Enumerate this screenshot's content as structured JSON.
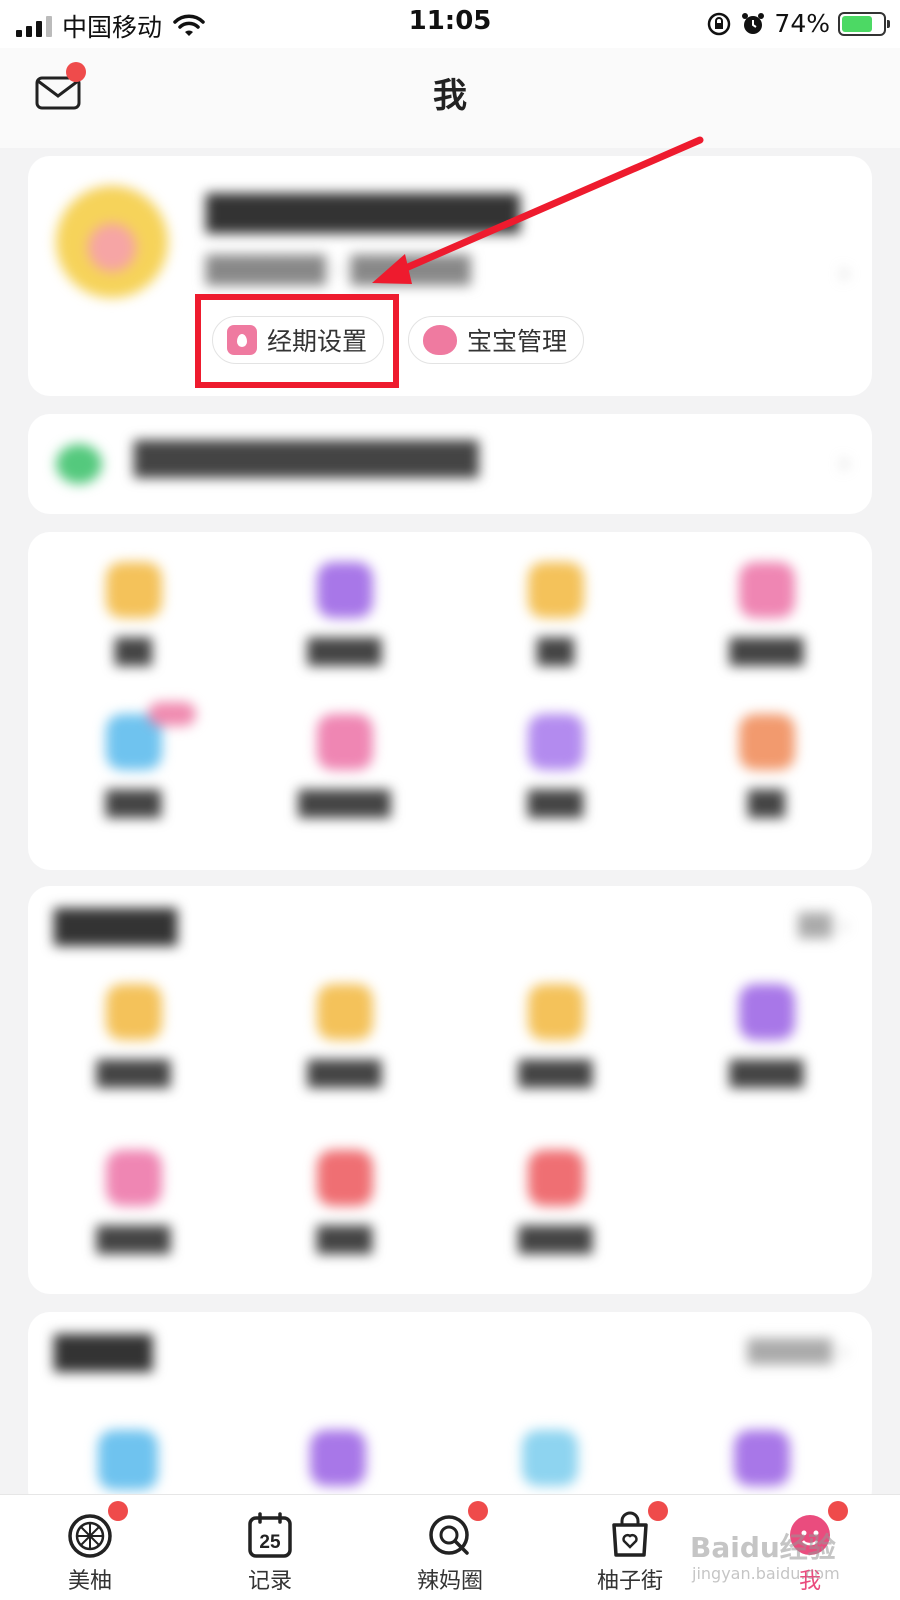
{
  "status_bar": {
    "carrier": "中国移动",
    "time": "11:05",
    "battery": "74%",
    "battery_level": 0.74
  },
  "header": {
    "title": "我",
    "mail_icon": "mail-icon"
  },
  "profile": {
    "chips": [
      {
        "label": "经期设置",
        "icon": "period-calendar-icon"
      },
      {
        "label": "宝宝管理",
        "icon": "baby-icon"
      }
    ]
  },
  "colors": {
    "accent": "#ea4c7e",
    "annotation_red": "#ee1b2e",
    "badge_red": "#ef4b4b"
  },
  "tabbar": {
    "tabs": [
      {
        "label": "美柚",
        "icon": "meiyou-icon",
        "badge": true
      },
      {
        "label": "记录",
        "icon": "calendar-25-icon",
        "badge": false,
        "number": "25"
      },
      {
        "label": "辣妈圈",
        "icon": "circle-search-icon",
        "badge": true
      },
      {
        "label": "柚子街",
        "icon": "shopping-bag-icon",
        "badge": true
      },
      {
        "label": "我",
        "icon": "me-icon",
        "badge": true,
        "active": true
      }
    ]
  },
  "watermark": {
    "text": "Baidu经验",
    "sub": "jingyan.baidu.com"
  }
}
